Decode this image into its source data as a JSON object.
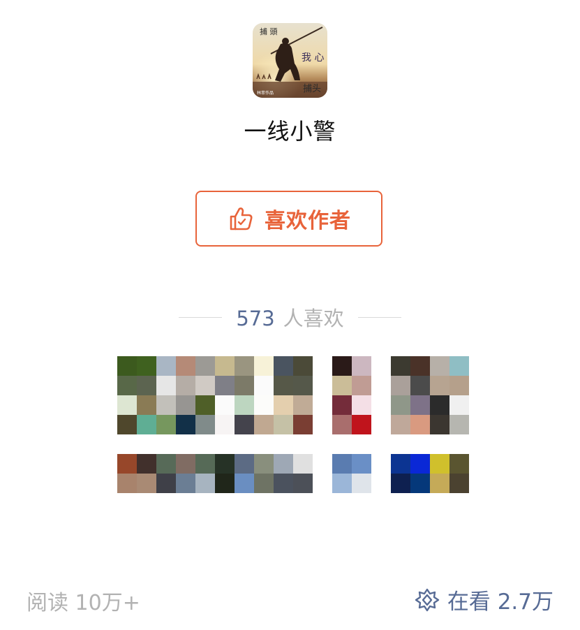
{
  "author": {
    "avatar_icon": "author-avatar-painting",
    "avatar_text": {
      "title": "捕头",
      "side": "捕\n頭",
      "verse": "我\n心",
      "seal": "林萃作品"
    },
    "name": "一线小警"
  },
  "like_button": {
    "label": "喜欢作者",
    "icon": "thumbs-up-icon",
    "color": "#e8633a"
  },
  "likers": {
    "count": "573",
    "suffix": "人喜欢",
    "accent_color": "#576b95"
  },
  "footer": {
    "read_label": "阅读 10万+",
    "wow_label": "在看 2.7万",
    "wow_icon": "wow-flower-icon"
  }
}
